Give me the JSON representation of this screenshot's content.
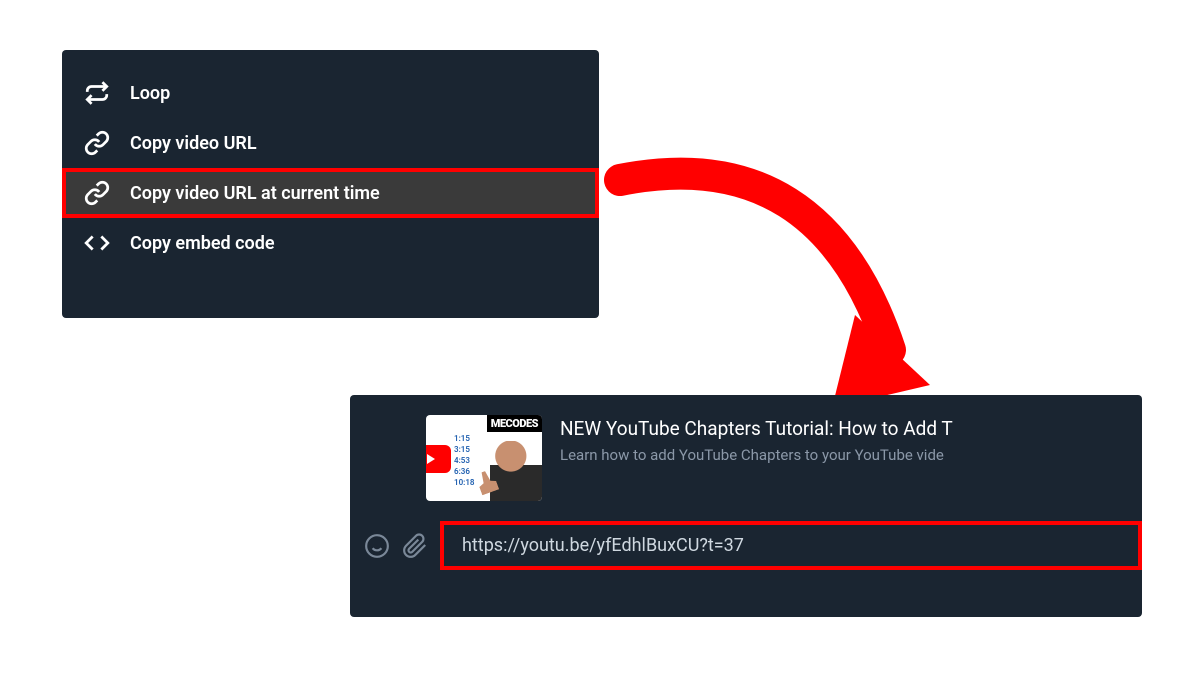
{
  "context_menu": {
    "items": [
      {
        "label": "Loop",
        "highlighted": false
      },
      {
        "label": "Copy video URL",
        "highlighted": false
      },
      {
        "label": "Copy video URL at current time",
        "highlighted": true
      },
      {
        "label": "Copy embed code",
        "highlighted": false
      }
    ]
  },
  "chat": {
    "preview": {
      "thumb_header": "MECODES",
      "thumb_times": [
        "1:15",
        "3:15",
        "4:53",
        "6:36",
        "10:18"
      ],
      "title": "NEW YouTube Chapters Tutorial: How to Add T",
      "description": "Learn how to add YouTube Chapters to your YouTube vide"
    },
    "input": {
      "url": "https://youtu.be/yfEdhlBuxCU?t=37"
    }
  },
  "colors": {
    "highlight_border": "#ff0000",
    "panel_bg": "#1a2531"
  }
}
